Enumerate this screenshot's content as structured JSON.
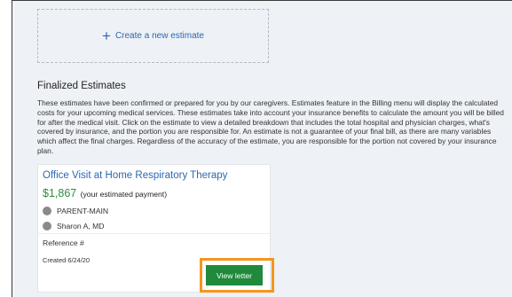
{
  "new_estimate": {
    "label": "Create a new estimate",
    "icon": "plus-icon"
  },
  "section": {
    "title": "Finalized Estimates",
    "description": "These estimates have been confirmed or prepared for you by our caregivers. Estimates feature in the Billing menu will display the calculated costs for your upcoming medical services. These estimates take into account your insurance benefits to calculate the amount you will be billed for after the medical visit. Click on the estimate to view a detailed breakdown that includes the total hospital and physician charges, what's covered by insurance, and the portion you are responsible for. An estimate is not a guarantee of your final bill, as there are many variables which affect the final charges. Regardless of the accuracy of the estimate, you are responsible for the portion not covered by your insurance plan."
  },
  "card": {
    "title": "Office Visit at Home Respiratory Therapy",
    "amount": "$1,867",
    "amount_note": "(your estimated payment)",
    "department": "PARENT-MAIN",
    "provider": "Sharon A, MD",
    "reference": "Reference #",
    "created": "Created 6/24/20",
    "button": "View letter"
  },
  "colors": {
    "accent": "#2c67b0",
    "amount": "#2e8b3e",
    "button": "#1f8a3c",
    "highlight": "#f5951f"
  }
}
